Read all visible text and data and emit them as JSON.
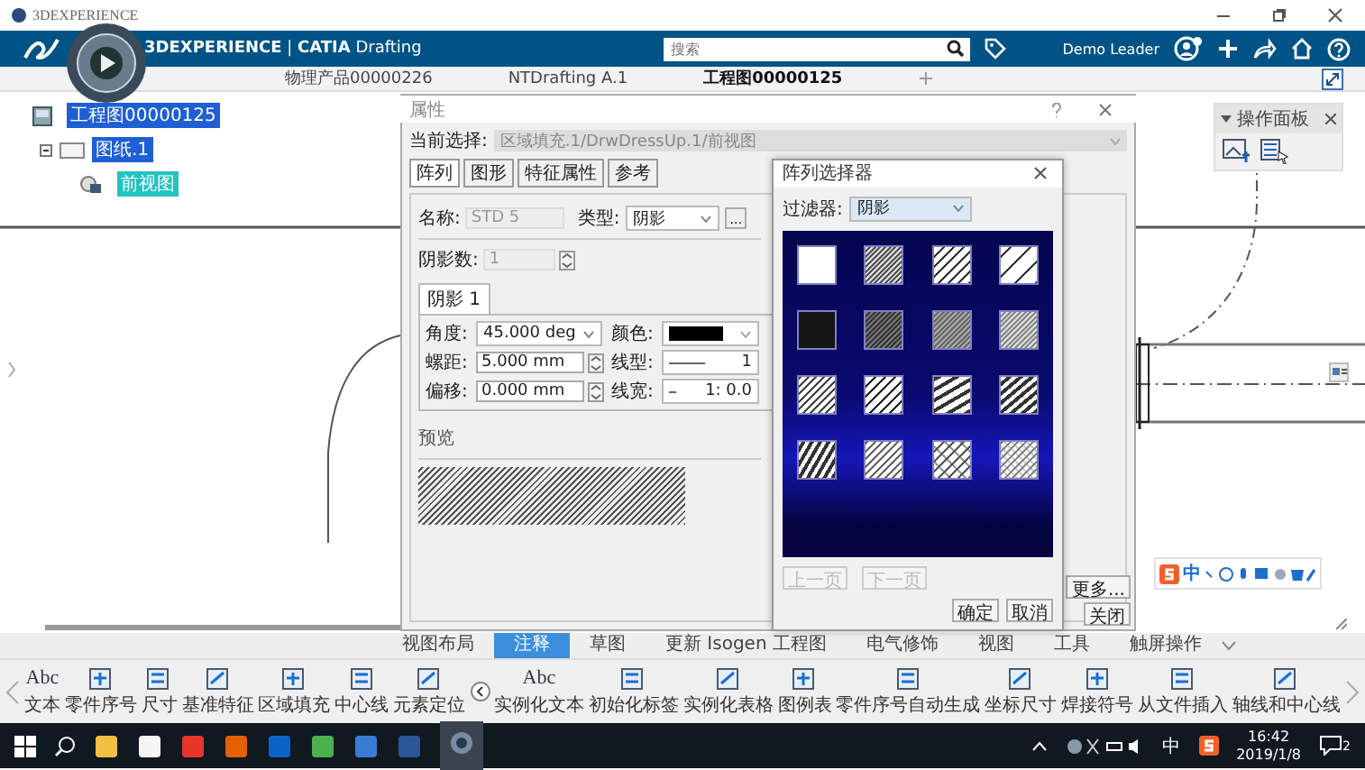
{
  "window": {
    "title": "3DEXPERIENCE"
  },
  "header": {
    "brand": "**3DEXPERIENCE** | **CATIA** Drafting",
    "search": {
      "placeholder": "搜索"
    },
    "user": "Demo Leader"
  },
  "tabs": [
    {
      "label": "物理产品00000226",
      "selected": false
    },
    {
      "label": "NTDrafting A.1",
      "selected": false
    },
    {
      "label": "工程图00000125",
      "selected": true
    }
  ],
  "tree": [
    {
      "label": "工程图00000125",
      "selected": true,
      "active": false,
      "children": [
        {
          "label": "图纸.1",
          "selected": true,
          "active": false,
          "children": [
            {
              "label": "前视图",
              "selected": true,
              "active": true
            }
          ]
        }
      ]
    }
  ],
  "panel": {
    "title": "操作面板"
  },
  "properties_dialog": {
    "title": "属性",
    "current_selection_label": "当前选择:",
    "current_selection": "区域填充.1/DrwDressUp.1/前视图",
    "tabs": [
      {
        "label": "阵列",
        "selected": true
      },
      {
        "label": "图形",
        "selected": false
      },
      {
        "label": "特征属性",
        "selected": false
      },
      {
        "label": "参考",
        "selected": false
      }
    ],
    "name": {
      "label": "名称:",
      "value": "STD 5",
      "disabled": true
    },
    "type": {
      "label": "类型:",
      "value": "阴影"
    },
    "more_dots": "...",
    "hatch_count": {
      "label": "阴影数:",
      "value": "1",
      "disabled": true
    },
    "hatch_tab": "阴影 1",
    "fields": [
      {
        "label": "角度:",
        "value": "45.000 deg",
        "kind": "dropdown"
      },
      {
        "label": "螺距:",
        "value": "5.000 mm",
        "kind": "spinner"
      },
      {
        "label": "偏移:",
        "value": "0.000 mm",
        "kind": "spinner"
      }
    ],
    "attributes": [
      {
        "label": "颜色:",
        "kind": "color",
        "color": "#000000"
      },
      {
        "label": "线型:",
        "kind": "linetype",
        "value": "1"
      },
      {
        "label": "线宽:",
        "kind": "lineweight",
        "value": "1: 0.0"
      }
    ],
    "preview_label": "预览",
    "buttons": [
      "更多...",
      "关闭"
    ]
  },
  "pattern_dialog": {
    "title": "阵列选择器",
    "filter_label": "过滤器:",
    "filter": "阴影",
    "swatches": [
      {
        "kind": "blank"
      },
      {
        "kind": "hatch-fine"
      },
      {
        "kind": "hatch-medium"
      },
      {
        "kind": "hatch-wide"
      },
      {
        "kind": "solid-black"
      },
      {
        "kind": "hatch-dark"
      },
      {
        "kind": "hatch-gray"
      },
      {
        "kind": "hatch-light"
      },
      {
        "kind": "hatch-thin"
      },
      {
        "kind": "hatch-normal"
      },
      {
        "kind": "hatch-bold"
      },
      {
        "kind": "hatch-heavy"
      },
      {
        "kind": "hatch-steep"
      },
      {
        "kind": "hatch-dashed"
      },
      {
        "kind": "hatch-cross"
      },
      {
        "kind": "hatch-dotted"
      }
    ],
    "nav": [
      {
        "label": "上一页",
        "disabled": true
      },
      {
        "label": "下一页",
        "disabled": true
      }
    ],
    "buttons": [
      "确定",
      "取消"
    ]
  },
  "ime_bar": {
    "label": "中"
  },
  "toolbar_tabs": [
    {
      "label": "视图布局",
      "selected": false
    },
    {
      "label": "注释",
      "selected": true
    },
    {
      "label": "草图",
      "selected": false
    },
    {
      "label": "更新 Isogen 工程图",
      "selected": false
    },
    {
      "label": "电气修饰",
      "selected": false
    },
    {
      "label": "视图",
      "selected": false
    },
    {
      "label": "工具",
      "selected": false
    },
    {
      "label": "触屏操作",
      "selected": false
    }
  ],
  "tools": [
    {
      "label": "文本",
      "glyph": "Abc"
    },
    {
      "label": "零件序号"
    },
    {
      "label": "尺寸"
    },
    {
      "label": "基准特征"
    },
    {
      "label": "区域填充"
    },
    {
      "label": "中心线"
    },
    {
      "label": "元素定位"
    },
    {
      "label": "实例化文本",
      "glyph": "Abc"
    },
    {
      "label": "初始化标签"
    },
    {
      "label": "实例化表格"
    },
    {
      "label": "图例表"
    },
    {
      "label": "零件序号自动生成"
    },
    {
      "label": "坐标尺寸"
    },
    {
      "label": "焊接符号"
    },
    {
      "label": "从文件插入"
    },
    {
      "label": "轴线和中心线"
    }
  ],
  "taskbar": {
    "ime": "中",
    "time": "16:42",
    "date": "2019/1/8",
    "notifications": "2"
  }
}
